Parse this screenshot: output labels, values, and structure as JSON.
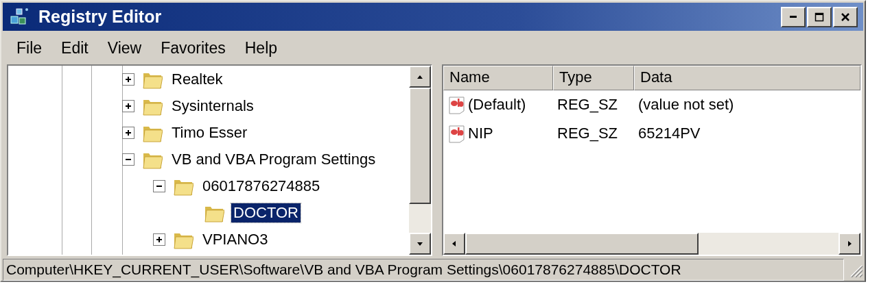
{
  "window": {
    "title": "Registry Editor"
  },
  "menu": [
    "File",
    "Edit",
    "View",
    "Favorites",
    "Help"
  ],
  "tree": {
    "items": [
      {
        "label": "Realtek",
        "has_children": true,
        "expanded": false,
        "selected": false
      },
      {
        "label": "Sysinternals",
        "has_children": true,
        "expanded": false,
        "selected": false
      },
      {
        "label": "Timo Esser",
        "has_children": true,
        "expanded": false,
        "selected": false
      },
      {
        "label": "VB and VBA Program Settings",
        "has_children": true,
        "expanded": true,
        "selected": false,
        "children": [
          {
            "label": "06017876274885",
            "has_children": true,
            "expanded": true,
            "selected": false,
            "children": [
              {
                "label": "DOCTOR",
                "has_children": false,
                "selected": true
              }
            ]
          },
          {
            "label": "VPIANO3",
            "has_children": true,
            "expanded": false,
            "selected": false
          }
        ]
      }
    ]
  },
  "values": {
    "columns": [
      "Name",
      "Type",
      "Data"
    ],
    "rows": [
      {
        "name": "(Default)",
        "type": "REG_SZ",
        "data": "(value not set)"
      },
      {
        "name": "NIP",
        "type": "REG_SZ",
        "data": "65214PV"
      }
    ]
  },
  "status_bar": "Computer\\HKEY_CURRENT_USER\\Software\\VB and VBA Program Settings\\06017876274885\\DOCTOR"
}
